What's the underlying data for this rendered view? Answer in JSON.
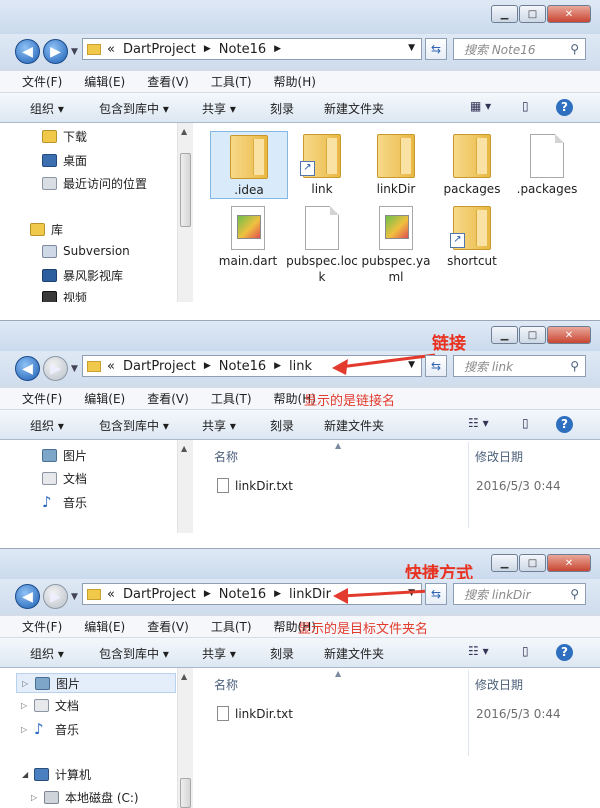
{
  "panel1": {
    "window_buttons": {
      "minimize": "▁",
      "maximize": "□",
      "close": "✕"
    },
    "nav": {
      "back_icon": "arrow-left-icon",
      "forward_icon": "arrow-right-icon"
    },
    "address": {
      "chevrons": "«",
      "crumbs": [
        "DartProject",
        "Note16"
      ]
    },
    "search_placeholder": "搜索 Note16",
    "menu": [
      "文件(F)",
      "编辑(E)",
      "查看(V)",
      "工具(T)",
      "帮助(H)"
    ],
    "commands": [
      "组织",
      "包含到库中",
      "共享",
      "刻录",
      "新建文件夹"
    ],
    "nav_items": [
      "下载",
      "桌面",
      "最近访问的位置",
      "库",
      "Subversion",
      "暴风影视库",
      "视频"
    ],
    "files": [
      {
        "name": ".idea",
        "type": "folder",
        "selected": true
      },
      {
        "name": "link",
        "type": "folder-shortcut"
      },
      {
        "name": "linkDir",
        "type": "folder"
      },
      {
        "name": "packages",
        "type": "folder"
      },
      {
        "name": ".packages",
        "type": "file"
      },
      {
        "name": "main.dart",
        "type": "dart-file"
      },
      {
        "name": "pubspec.lock",
        "type": "file"
      },
      {
        "name": "pubspec.yaml",
        "type": "dart-file"
      },
      {
        "name": "shortcut",
        "type": "folder-shortcut"
      }
    ]
  },
  "panel2": {
    "address": {
      "chevrons": "«",
      "crumbs": [
        "DartProject",
        "Note16",
        "link"
      ]
    },
    "search_placeholder": "搜索 link",
    "annotation_title": "链接",
    "annotation_note": "显示的是链接名",
    "menu": [
      "文件(F)",
      "编辑(E)",
      "查看(V)",
      "工具(T)",
      "帮助(H)"
    ],
    "commands": [
      "组织",
      "包含到库中",
      "共享",
      "刻录",
      "新建文件夹"
    ],
    "nav_items": [
      "图片",
      "文档",
      "音乐"
    ],
    "columns": {
      "name": "名称",
      "modified": "修改日期"
    },
    "rows": [
      {
        "name": "linkDir.txt",
        "modified": "2016/5/3 0:44"
      }
    ]
  },
  "panel3": {
    "address": {
      "chevrons": "«",
      "crumbs": [
        "DartProject",
        "Note16",
        "linkDir"
      ]
    },
    "search_placeholder": "搜索 linkDir",
    "annotation_title": "快捷方式",
    "annotation_note": "显示的是目标文件夹名",
    "menu": [
      "文件(F)",
      "编辑(E)",
      "查看(V)",
      "工具(T)",
      "帮助(H)"
    ],
    "commands": [
      "组织",
      "包含到库中",
      "共享",
      "刻录",
      "新建文件夹"
    ],
    "nav_items": [
      "图片",
      "文档",
      "音乐",
      "计算机",
      "本地磁盘 (C:)"
    ],
    "columns": {
      "name": "名称",
      "modified": "修改日期"
    },
    "rows": [
      {
        "name": "linkDir.txt",
        "modified": "2016/5/3 0:44"
      }
    ]
  },
  "colors": {
    "annotation_red": "#e23b2e",
    "selection": "#d9ebfb"
  }
}
